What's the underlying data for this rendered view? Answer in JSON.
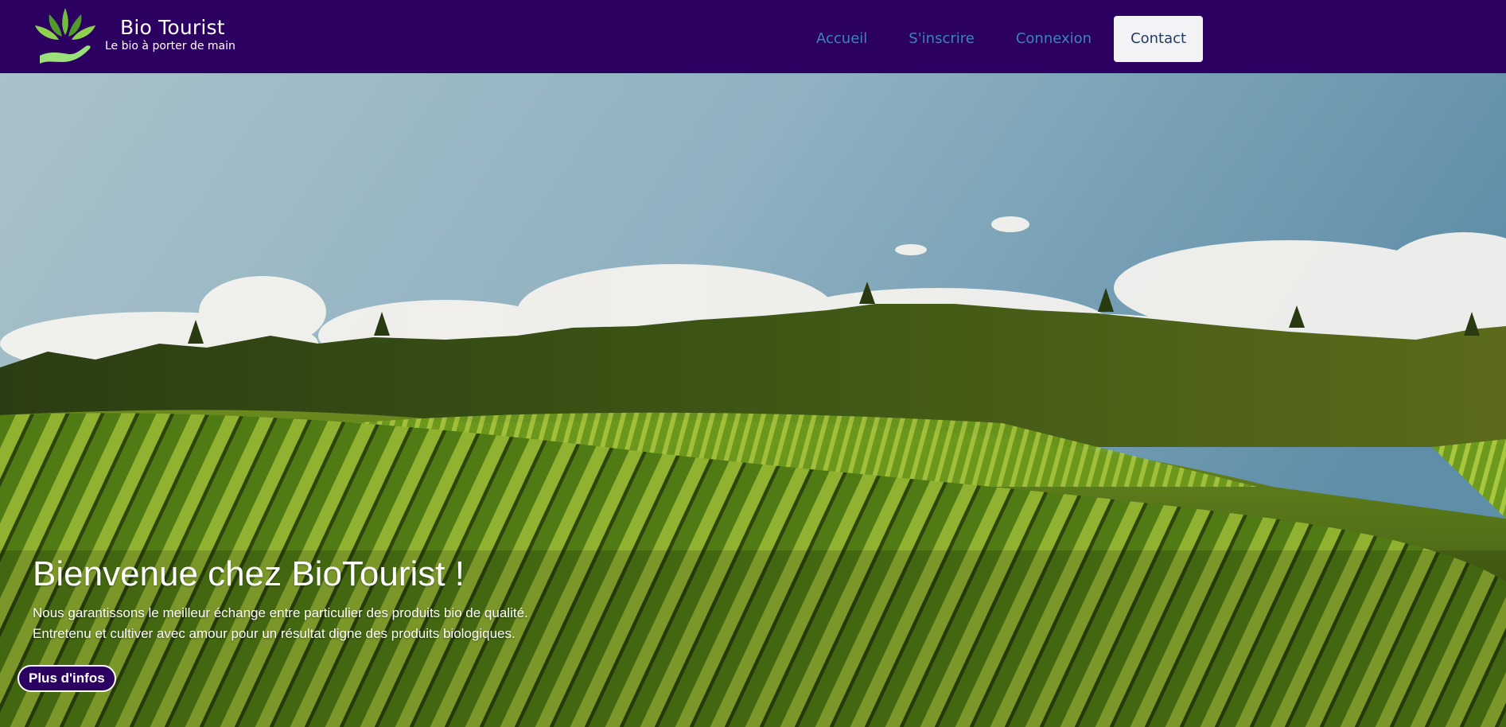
{
  "brand": {
    "name": "Bio Tourist",
    "tagline": "Le bio à porter de main",
    "logo_icon": "leaf-hand-logo-icon"
  },
  "nav": {
    "items": [
      {
        "label": "Accueil"
      },
      {
        "label": "S'inscrire"
      },
      {
        "label": "Connexion"
      },
      {
        "label": "Contact",
        "active": true
      }
    ]
  },
  "hero": {
    "title": "Bienvenue chez BioTourist !",
    "line1": "Nous garantissons le meilleur échange entre particulier des produits bio de qualité.",
    "line2": "Entretenu et cultiver avec amour pour un résultat digne des produits biologiques.",
    "cta_label": "Plus d'infos"
  },
  "colors": {
    "nav_bg": "#2b0061",
    "nav_link": "#3a86b6",
    "active_bg": "#f3f3f6",
    "button_bg": "#2b0061"
  }
}
